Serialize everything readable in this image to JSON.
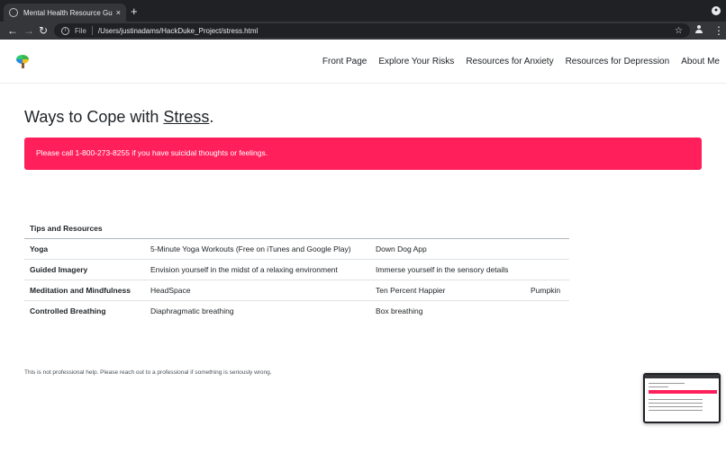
{
  "browser": {
    "tab_title": "Mental Health Resource Guide",
    "tab_close": "×",
    "new_tab": "+",
    "scheme": "File",
    "url": "/Users/justinadams/HackDuke_Project/stress.html"
  },
  "nav": {
    "links": [
      "Front Page",
      "Explore Your Risks",
      "Resources for Anxiety",
      "Resources for Depression",
      "About Me"
    ]
  },
  "heading": {
    "prefix": "Ways to Cope with ",
    "emphasis": "Stress",
    "suffix": "."
  },
  "alert": {
    "text": "Please call 1-800-273-8255 if you have suicidal thoughts or feelings.",
    "color": "#ff1f5b"
  },
  "table": {
    "header": "Tips and Resources",
    "rows": [
      {
        "label": "Yoga",
        "cells": [
          "5-Minute Yoga Workouts (Free on iTunes and Google Play)",
          "Down Dog App",
          ""
        ]
      },
      {
        "label": "Guided Imagery",
        "cells": [
          "Envision yourself in the midst of a relaxing environment",
          "Immerse yourself in the sensory details",
          ""
        ]
      },
      {
        "label": "Meditation and Mindfulness",
        "cells": [
          "HeadSpace",
          "Ten Percent Happier",
          "Pumpkin"
        ]
      },
      {
        "label": "Controlled Breathing",
        "cells": [
          "Diaphragmatic breathing",
          "Box breathing",
          ""
        ]
      }
    ]
  },
  "footer": {
    "text": "This is not professional help. Please reach out to a professional if something is seriously wrong."
  },
  "icons": {
    "favicon": "globe-icon",
    "info": "info-icon",
    "star": "star-icon",
    "profile": "profile-icon",
    "menu": "kebab-menu-icon",
    "logo": "tree-logo-icon"
  }
}
